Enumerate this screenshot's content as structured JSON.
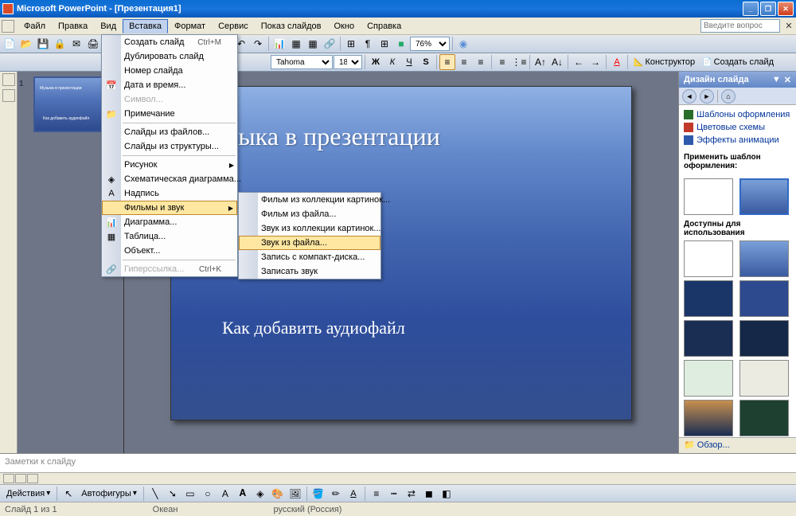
{
  "title": "Microsoft PowerPoint  - [Презентация1]",
  "menubar": [
    "Файл",
    "Правка",
    "Вид",
    "Вставка",
    "Формат",
    "Сервис",
    "Показ слайдов",
    "Окно",
    "Справка"
  ],
  "helpbox_placeholder": "Введите вопрос",
  "zoom": "76%",
  "font": {
    "family": "Tahoma",
    "size": "18"
  },
  "toolbar_labels": {
    "designer": "Конструктор",
    "new_slide": "Создать слайд"
  },
  "insert_menu": {
    "items": [
      {
        "label": "Создать слайд",
        "shortcut": "Ctrl+M",
        "icon": ""
      },
      {
        "label": "Дублировать слайд"
      },
      {
        "label": "Номер слайда"
      },
      {
        "label": "Дата и время...",
        "icon": "📅"
      },
      {
        "label": "Символ...",
        "disabled": true
      },
      {
        "label": "Примечание",
        "icon": "📁"
      },
      {
        "sep": true
      },
      {
        "label": "Слайды из файлов..."
      },
      {
        "label": "Слайды из структуры..."
      },
      {
        "sep": true
      },
      {
        "label": "Рисунок",
        "submenu": true
      },
      {
        "label": "Схематическая диаграмма...",
        "icon": "◈"
      },
      {
        "label": "Надпись",
        "icon": "A"
      },
      {
        "label": "Фильмы и звук",
        "submenu": true,
        "highlighted": true
      },
      {
        "label": "Диаграмма...",
        "icon": "📊"
      },
      {
        "label": "Таблица...",
        "icon": "▦"
      },
      {
        "label": "Объект..."
      },
      {
        "sep": true
      },
      {
        "label": "Гиперссылка...",
        "shortcut": "Ctrl+K",
        "disabled": true,
        "icon": "🔗"
      }
    ]
  },
  "movies_sound_submenu": [
    {
      "label": "Фильм из коллекции картинок..."
    },
    {
      "label": "Фильм из файла..."
    },
    {
      "label": "Звук из коллекции картинок..."
    },
    {
      "label": "Звук из файла...",
      "highlighted": true
    },
    {
      "label": "Запись с компакт-диска..."
    },
    {
      "label": "Записать звук"
    }
  ],
  "slide": {
    "title": "Музыка в презентации",
    "subtitle": "Как добавить аудиофайл"
  },
  "thumb_num": "1",
  "notes_placeholder": "Заметки к слайду",
  "panel": {
    "title": "Дизайн слайда",
    "links": [
      {
        "label": "Шаблоны оформления",
        "color": "#296e2b"
      },
      {
        "label": "Цветовые схемы",
        "color": "#c0392b"
      },
      {
        "label": "Эффекты анимации",
        "color": "#2e5aab"
      }
    ],
    "apply_label": "Применить шаблон оформления:",
    "available_label": "Доступны для использования",
    "browse": "Обзор..."
  },
  "draw_toolbar": {
    "actions": "Действия",
    "autoshapes": "Автофигуры"
  },
  "status": {
    "slide": "Слайд 1 из 1",
    "theme": "Океан",
    "lang": "русский (Россия)"
  }
}
